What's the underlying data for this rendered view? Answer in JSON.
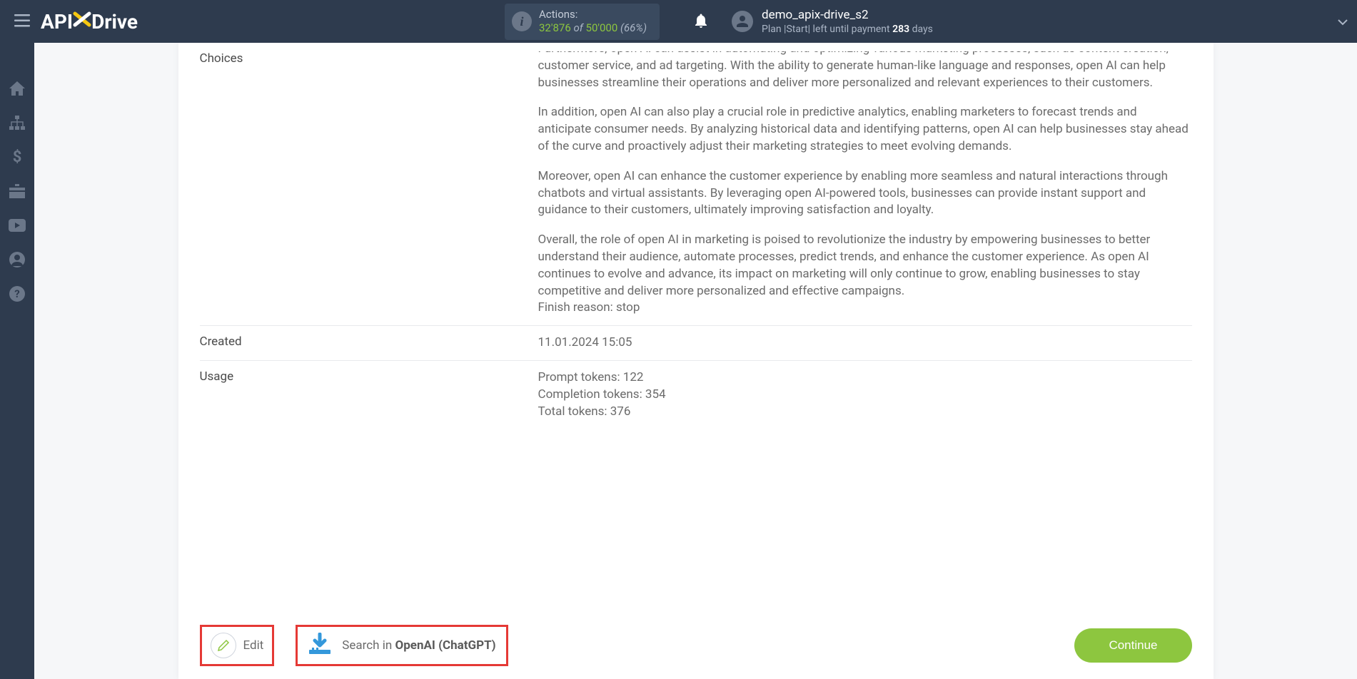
{
  "header": {
    "logo_api": "API",
    "logo_drive": "Drive",
    "actions": {
      "label": "Actions:",
      "used": "32'876",
      "of": " of ",
      "total": "50'000",
      "pct": " (66%)"
    },
    "user": {
      "name": "demo_apix-drive_s2",
      "plan_prefix": "Plan |Start| left until payment ",
      "plan_days": "283",
      "plan_suffix": " days"
    }
  },
  "rows": {
    "choices": {
      "label": "Choices",
      "p1": "Furthermore, open AI can assist in automating and optimizing various marketing processes, such as content creation, customer service, and ad targeting. With the ability to generate human-like language and responses, open AI can help businesses streamline their operations and deliver more personalized and relevant experiences to their customers.",
      "p2": "In addition, open AI can also play a crucial role in predictive analytics, enabling marketers to forecast trends and anticipate consumer needs. By analyzing historical data and identifying patterns, open AI can help businesses stay ahead of the curve and proactively adjust their marketing strategies to meet evolving demands.",
      "p3": "Moreover, open AI can enhance the customer experience by enabling more seamless and natural interactions through chatbots and virtual assistants. By leveraging open AI-powered tools, businesses can provide instant support and guidance to their customers, ultimately improving satisfaction and loyalty.",
      "p4": "Overall, the role of open AI in marketing is poised to revolutionize the industry by empowering businesses to better understand their audience, automate processes, predict trends, and enhance the customer experience. As open AI continues to evolve and advance, its impact on marketing will only continue to grow, enabling businesses to stay competitive and deliver more personalized and effective campaigns.",
      "finish_reason": "Finish reason: stop"
    },
    "created": {
      "label": "Created",
      "value": "11.01.2024 15:05"
    },
    "usage": {
      "label": "Usage",
      "prompt": "Prompt tokens: 122",
      "completion": "Completion tokens: 354",
      "total": "Total tokens: 376"
    }
  },
  "footer": {
    "edit_label": "Edit",
    "search_prefix": "Search in ",
    "search_bold": "OpenAI (ChatGPT)",
    "continue_label": "Continue"
  }
}
